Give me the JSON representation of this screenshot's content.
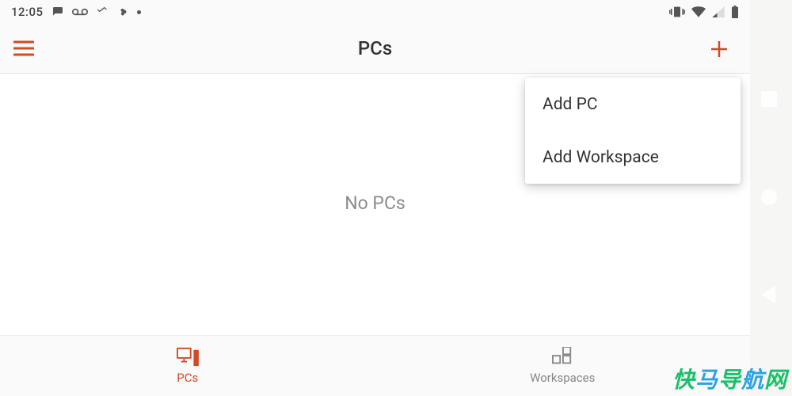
{
  "status": {
    "time": "12:05"
  },
  "appbar": {
    "title": "PCs"
  },
  "content": {
    "empty_label": "No PCs"
  },
  "popup": {
    "items": [
      {
        "label": "Add PC"
      },
      {
        "label": "Add Workspace"
      }
    ]
  },
  "bottomnav": {
    "items": [
      {
        "label": "PCs",
        "active": true
      },
      {
        "label": "Workspaces",
        "active": false
      }
    ]
  },
  "colors": {
    "accent": "#d24a24"
  },
  "watermark": "快马导航网"
}
